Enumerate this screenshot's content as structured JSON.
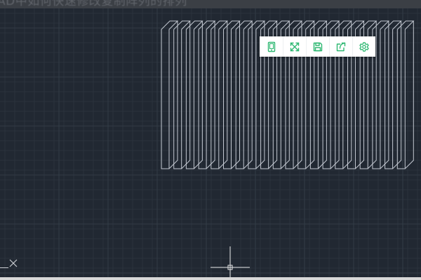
{
  "window": {
    "title": "AD中如何快速修改复制阵列的排列"
  },
  "toolbar": {
    "buttons": [
      {
        "name": "tablet-view",
        "icon": "tablet-icon"
      },
      {
        "name": "fullscreen",
        "icon": "expand-arrows-icon"
      },
      {
        "name": "save",
        "icon": "floppy-disk-icon"
      },
      {
        "name": "share",
        "icon": "share-icon"
      },
      {
        "name": "settings",
        "icon": "gear-icon"
      }
    ]
  },
  "drawing": {
    "array_items_visible": 20,
    "line_color": "#c3c8d1"
  },
  "colors": {
    "background": "#212832",
    "grid_minor": "#2a323c",
    "grid_major": "#333c47",
    "toolbar_icon": "#2eb872",
    "crosshair": "#e8e8e8"
  }
}
